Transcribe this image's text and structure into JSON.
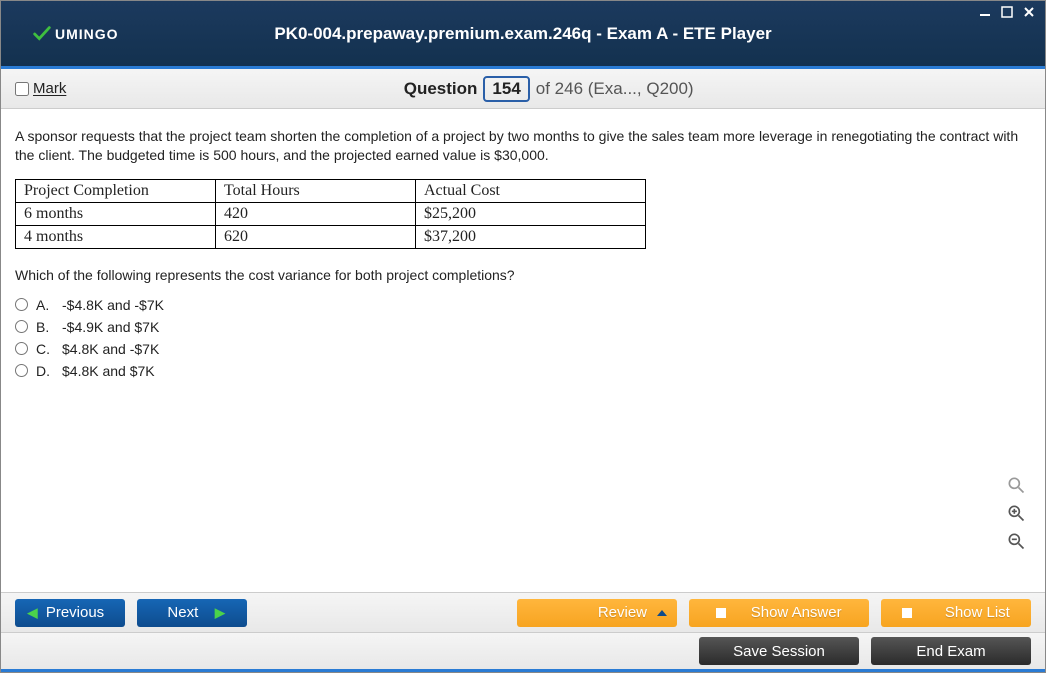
{
  "window": {
    "title": "PK0-004.prepaway.premium.exam.246q - Exam A - ETE Player",
    "logo_text": "UMINGO"
  },
  "questionBar": {
    "mark_label": "Mark",
    "word_question": "Question",
    "current": "154",
    "of_text": "of 246 (Exa..., Q200)"
  },
  "question": {
    "stem": "A sponsor requests that the project team shorten the completion of a project by two months to give the sales team more leverage in renegotiating the contract with the client. The budgeted time is 500 hours, and the projected earned value is $30,000.",
    "sub": "Which of the following represents the cost variance for both project completions?",
    "table": {
      "headers": [
        "Project Completion",
        "Total Hours",
        "Actual Cost"
      ],
      "rows": [
        [
          "6 months",
          "420",
          "$25,200"
        ],
        [
          "4 months",
          "620",
          "$37,200"
        ]
      ]
    },
    "options": [
      {
        "letter": "A.",
        "text": "-$4.8K and -$7K"
      },
      {
        "letter": "B.",
        "text": "-$4.9K and $7K"
      },
      {
        "letter": "C.",
        "text": "$4.8K and -$7K"
      },
      {
        "letter": "D.",
        "text": "$4.8K and $7K"
      }
    ]
  },
  "buttons": {
    "previous": "Previous",
    "next": "Next",
    "review": "Review",
    "show_answer": "Show Answer",
    "show_list": "Show List",
    "save_session": "Save Session",
    "end_exam": "End Exam"
  }
}
